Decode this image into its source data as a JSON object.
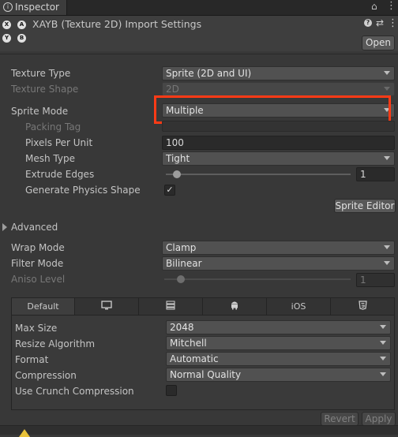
{
  "window": {
    "tab_title": "Inspector",
    "asset_title": "XAYB (Texture 2D) Import Settings",
    "open_button": "Open"
  },
  "platform_glyphs": [
    "X",
    "A",
    "Y",
    "B"
  ],
  "settings": {
    "texture_type": {
      "label": "Texture Type",
      "value": "Sprite (2D and UI)"
    },
    "texture_shape": {
      "label": "Texture Shape",
      "value": "2D"
    },
    "sprite_mode": {
      "label": "Sprite Mode",
      "value": "Multiple"
    },
    "packing_tag": {
      "label": "Packing Tag",
      "value": ""
    },
    "pixels_per_unit": {
      "label": "Pixels Per Unit",
      "value": "100"
    },
    "mesh_type": {
      "label": "Mesh Type",
      "value": "Tight"
    },
    "extrude_edges": {
      "label": "Extrude Edges",
      "value": "1",
      "fraction": 0.06
    },
    "generate_physics_shape": {
      "label": "Generate Physics Shape",
      "checked": true
    },
    "sprite_editor_button": "Sprite Editor",
    "advanced_label": "Advanced",
    "wrap_mode": {
      "label": "Wrap Mode",
      "value": "Clamp"
    },
    "filter_mode": {
      "label": "Filter Mode",
      "value": "Bilinear"
    },
    "aniso_level": {
      "label": "Aniso Level",
      "value": "1",
      "fraction": 0.09
    }
  },
  "platform_tabs": [
    {
      "label": "Default",
      "icon": ""
    },
    {
      "label": "",
      "icon": "monitor-icon"
    },
    {
      "label": "",
      "icon": "server-icon"
    },
    {
      "label": "",
      "icon": "android-icon"
    },
    {
      "label": "iOS",
      "icon": ""
    },
    {
      "label": "",
      "icon": "html5-icon"
    }
  ],
  "platform_settings": {
    "max_size": {
      "label": "Max Size",
      "value": "2048"
    },
    "resize_algorithm": {
      "label": "Resize Algorithm",
      "value": "Mitchell"
    },
    "format": {
      "label": "Format",
      "value": "Automatic"
    },
    "compression": {
      "label": "Compression",
      "value": "Normal Quality"
    },
    "use_crunch_compression": {
      "label": "Use Crunch Compression",
      "checked": false
    }
  },
  "footer": {
    "revert": "Revert",
    "apply": "Apply"
  },
  "colors": {
    "highlight": "#ff3b16",
    "background": "#383838"
  }
}
